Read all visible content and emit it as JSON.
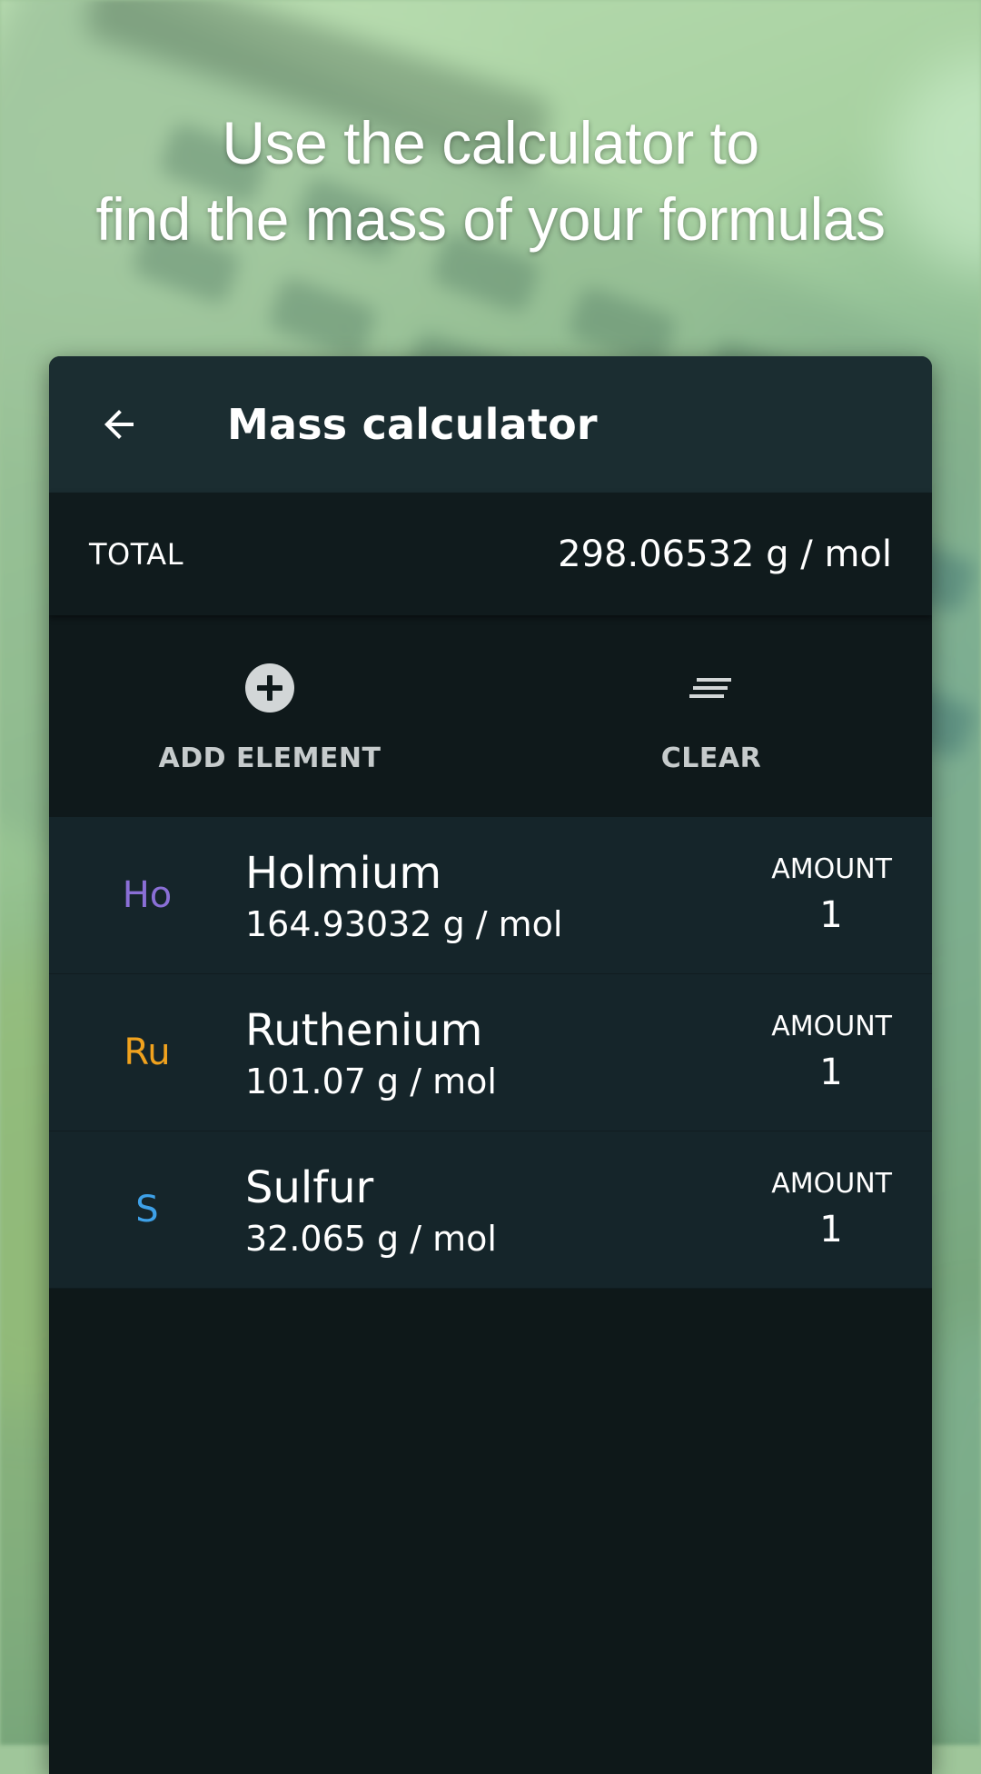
{
  "promo": {
    "line1": "Use the calculator to",
    "line2": "find the mass of your formulas"
  },
  "appbar": {
    "title": "Mass calculator",
    "back_icon": "arrow-back-icon"
  },
  "total": {
    "label": "TOTAL",
    "value": "298.06532 g / mol"
  },
  "actions": {
    "add_label": "ADD ELEMENT",
    "add_icon": "add-circle-icon",
    "clear_label": "CLEAR",
    "clear_icon": "clear-all-icon"
  },
  "elements": [
    {
      "symbol": "Ho",
      "name": "Holmium",
      "mass": "164.93032 g / mol",
      "amount_label": "AMOUNT",
      "amount": "1",
      "color": "#8a6fd6"
    },
    {
      "symbol": "Ru",
      "name": "Ruthenium",
      "mass": "101.07 g / mol",
      "amount_label": "AMOUNT",
      "amount": "1",
      "color": "#f0a21e"
    },
    {
      "symbol": "S",
      "name": "Sulfur",
      "mass": "32.065 g / mol",
      "amount_label": "AMOUNT",
      "amount": "1",
      "color": "#3ea1e8"
    }
  ],
  "colors": {
    "appbar": "#1b2d31",
    "card": "#0e1819",
    "row": "#15252a"
  }
}
